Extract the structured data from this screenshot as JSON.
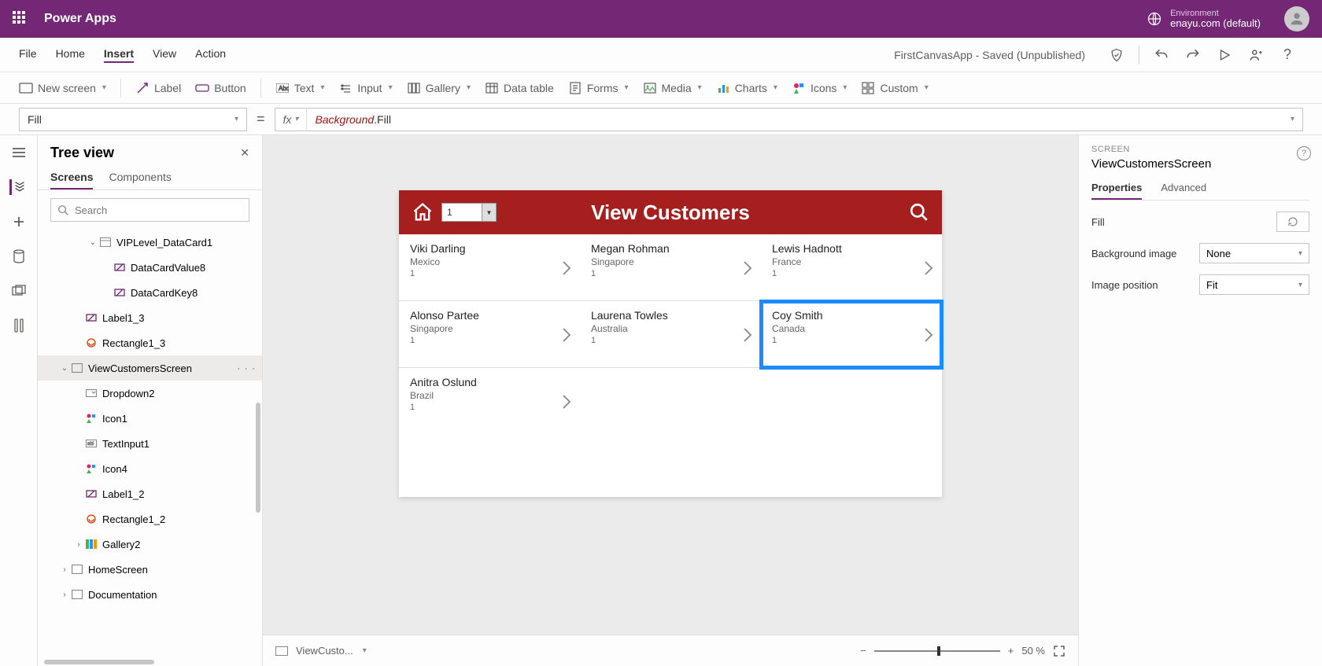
{
  "topbar": {
    "app": "Power Apps",
    "env_label": "Environment",
    "env_value": "enayu.com (default)"
  },
  "menubar": {
    "items": [
      "File",
      "Home",
      "Insert",
      "View",
      "Action"
    ],
    "active_index": 2,
    "doc_status": "FirstCanvasApp - Saved (Unpublished)"
  },
  "ribbon": {
    "items": [
      "New screen",
      "Label",
      "Button",
      "Text",
      "Input",
      "Gallery",
      "Data table",
      "Forms",
      "Media",
      "Charts",
      "Icons",
      "Custom"
    ]
  },
  "formulabar": {
    "property": "Fill",
    "fx_label": "fx",
    "token1": "Background",
    "token2": ".Fill"
  },
  "treeview": {
    "title": "Tree view",
    "tabs": [
      "Screens",
      "Components"
    ],
    "active_tab": 0,
    "search_placeholder": "Search",
    "nodes": [
      {
        "indent": 3,
        "twisty": "v",
        "icon": "datacard",
        "label": "VIPLevel_DataCard1"
      },
      {
        "indent": 4,
        "twisty": "",
        "icon": "field",
        "label": "DataCardValue8"
      },
      {
        "indent": 4,
        "twisty": "",
        "icon": "field",
        "label": "DataCardKey8"
      },
      {
        "indent": 2,
        "twisty": "",
        "icon": "label",
        "label": "Label1_3"
      },
      {
        "indent": 2,
        "twisty": "",
        "icon": "rect",
        "label": "Rectangle1_3"
      },
      {
        "indent": 1,
        "twisty": "v",
        "icon": "screen",
        "label": "ViewCustomersScreen",
        "selected": true,
        "more": true
      },
      {
        "indent": 2,
        "twisty": "",
        "icon": "dropdown",
        "label": "Dropdown2"
      },
      {
        "indent": 2,
        "twisty": "",
        "icon": "icon",
        "label": "Icon1"
      },
      {
        "indent": 2,
        "twisty": "",
        "icon": "textinput",
        "label": "TextInput1"
      },
      {
        "indent": 2,
        "twisty": "",
        "icon": "icon",
        "label": "Icon4"
      },
      {
        "indent": 2,
        "twisty": "",
        "icon": "label",
        "label": "Label1_2"
      },
      {
        "indent": 2,
        "twisty": "",
        "icon": "rect",
        "label": "Rectangle1_2"
      },
      {
        "indent": 2,
        "twisty": ">",
        "icon": "gallery",
        "label": "Gallery2"
      },
      {
        "indent": 1,
        "twisty": ">",
        "icon": "screen",
        "label": "HomeScreen"
      },
      {
        "indent": 1,
        "twisty": ">",
        "icon": "screen",
        "label": "Documentation"
      }
    ]
  },
  "canvas": {
    "header_title": "View Customers",
    "dropdown_value": "1",
    "customers": [
      {
        "name": "Viki  Darling",
        "country": "Mexico",
        "vip": "1"
      },
      {
        "name": "Megan  Rohman",
        "country": "Singapore",
        "vip": "1"
      },
      {
        "name": "Lewis  Hadnott",
        "country": "France",
        "vip": "1"
      },
      {
        "name": "Alonso  Partee",
        "country": "Singapore",
        "vip": "1"
      },
      {
        "name": "Laurena  Towles",
        "country": "Australia",
        "vip": "1"
      },
      {
        "name": "Coy  Smith",
        "country": "Canada",
        "vip": "1",
        "selected": true
      },
      {
        "name": "Anitra  Oslund",
        "country": "Brazil",
        "vip": "1",
        "last": true
      }
    ],
    "breadcrumb": "ViewCusto...",
    "zoom": "50  %"
  },
  "properties": {
    "type": "SCREEN",
    "name": "ViewCustomersScreen",
    "tabs": [
      "Properties",
      "Advanced"
    ],
    "active_tab": 0,
    "rows": {
      "fill": "Fill",
      "bgimg": "Background image",
      "bgimg_val": "None",
      "imgpos": "Image position",
      "imgpos_val": "Fit"
    }
  }
}
